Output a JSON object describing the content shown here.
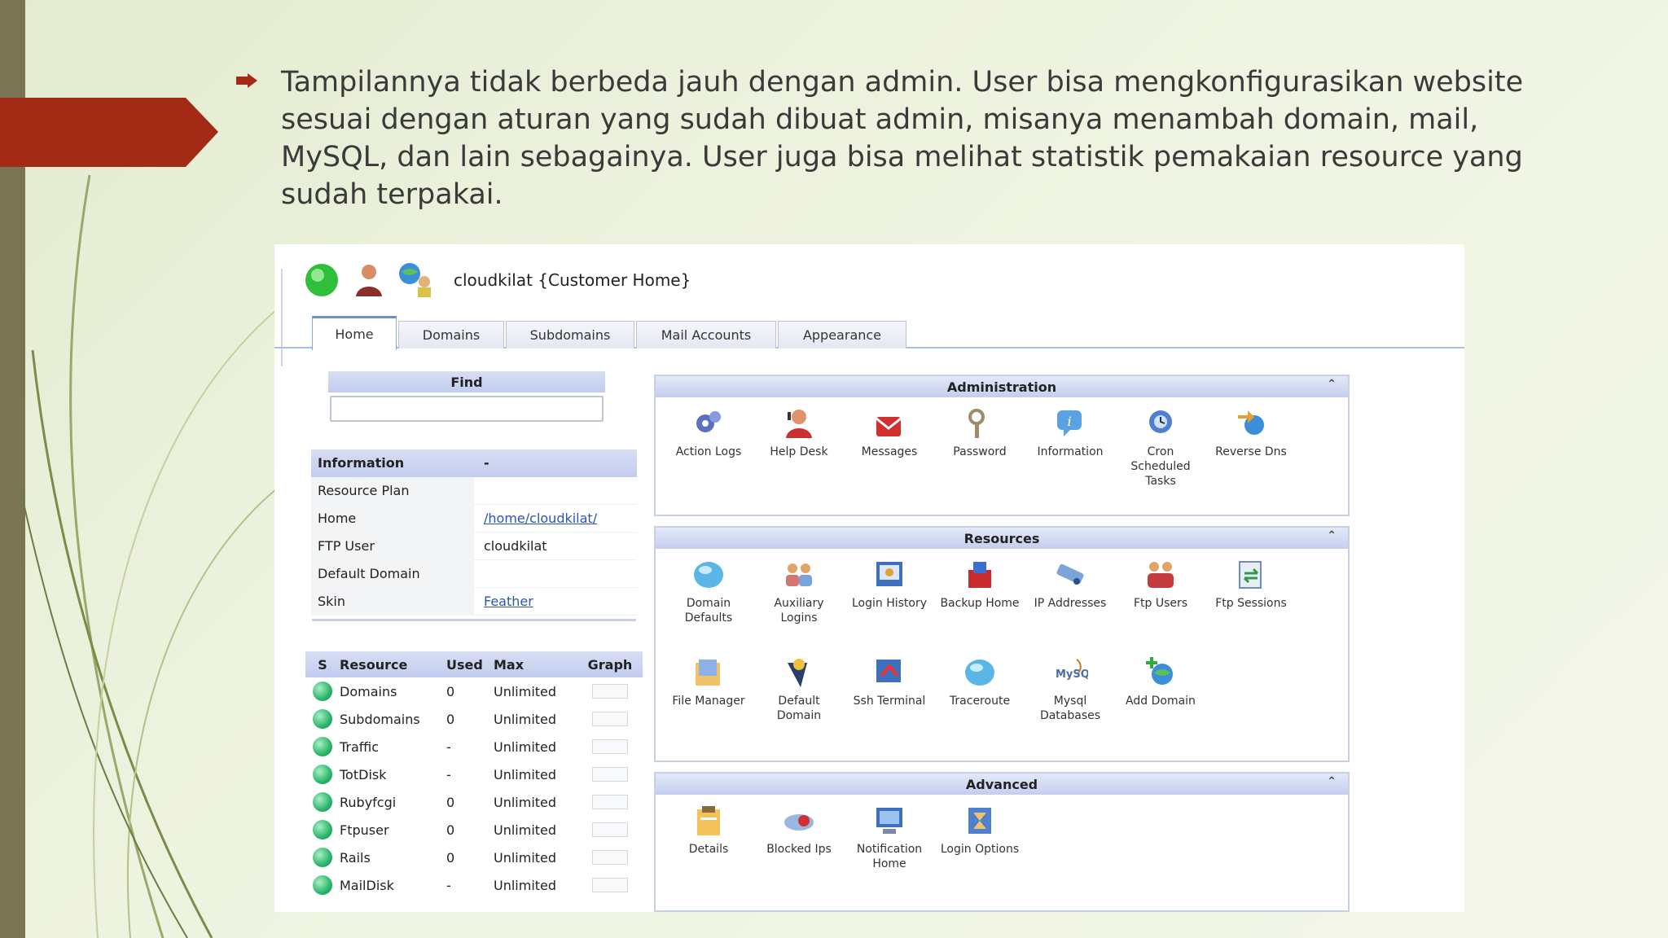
{
  "slide": {
    "bullet_text": "Tampilannya tidak berbeda jauh dengan admin. User bisa mengkonfigurasikan website sesuai dengan aturan yang sudah dibuat admin, misanya menambah domain, mail, MySQL, dan lain sebagainya. User juga bisa melihat statistik pemakaian resource yang sudah terpakai.",
    "colors": {
      "accent_red": "#a32a14",
      "left_bar": "#7a7452",
      "background": "#e8efda"
    }
  },
  "app": {
    "title": "cloudkilat {Customer Home}",
    "tabs": [
      "Home",
      "Domains",
      "Subdomains",
      "Mail Accounts",
      "Appearance"
    ],
    "active_tab": "Home"
  },
  "find": {
    "label": "Find",
    "value": ""
  },
  "info": {
    "header_key": "Information",
    "header_value": "-",
    "rows": [
      {
        "key": "Resource Plan",
        "value": ""
      },
      {
        "key": "Home",
        "value": "/home/cloudkilat/"
      },
      {
        "key": "FTP User",
        "value": "cloudkilat"
      },
      {
        "key": "Default Domain",
        "value": ""
      },
      {
        "key": "Skin",
        "value": "Feather"
      }
    ]
  },
  "resources_table": {
    "headers": [
      "S",
      "Resource",
      "Used",
      "Max",
      "Graph"
    ],
    "rows": [
      {
        "resource": "Domains",
        "used": "0",
        "max": "Unlimited"
      },
      {
        "resource": "Subdomains",
        "used": "0",
        "max": "Unlimited"
      },
      {
        "resource": "Traffic",
        "used": "-",
        "max": "Unlimited"
      },
      {
        "resource": "TotDisk",
        "used": "-",
        "max": "Unlimited"
      },
      {
        "resource": "Rubyfcgi",
        "used": "0",
        "max": "Unlimited"
      },
      {
        "resource": "Ftpuser",
        "used": "0",
        "max": "Unlimited"
      },
      {
        "resource": "Rails",
        "used": "0",
        "max": "Unlimited"
      },
      {
        "resource": "MailDisk",
        "used": "-",
        "max": "Unlimited"
      }
    ]
  },
  "sections": {
    "administration": {
      "title": "Administration",
      "items": [
        {
          "label": "Action Logs",
          "icon": "gears-icon"
        },
        {
          "label": "Help Desk",
          "icon": "help-desk-icon"
        },
        {
          "label": "Messages",
          "icon": "messages-icon"
        },
        {
          "label": "Password",
          "icon": "key-icon"
        },
        {
          "label": "Information",
          "icon": "info-icon"
        },
        {
          "label": "Cron Scheduled Tasks",
          "icon": "cron-icon"
        },
        {
          "label": "Reverse Dns",
          "icon": "reverse-dns-icon"
        }
      ]
    },
    "resources": {
      "title": "Resources",
      "items": [
        {
          "label": "Domain Defaults",
          "icon": "domain-defaults-icon"
        },
        {
          "label": "Auxiliary Logins",
          "icon": "users-icon"
        },
        {
          "label": "Login History",
          "icon": "login-history-icon"
        },
        {
          "label": "Backup Home",
          "icon": "backup-icon"
        },
        {
          "label": "IP Addresses",
          "icon": "ip-icon"
        },
        {
          "label": "Ftp Users",
          "icon": "ftp-users-icon"
        },
        {
          "label": "Ftp Sessions",
          "icon": "ftp-sessions-icon"
        },
        {
          "label": "File Manager",
          "icon": "file-manager-icon"
        },
        {
          "label": "Default Domain",
          "icon": "default-domain-icon"
        },
        {
          "label": "Ssh Terminal",
          "icon": "terminal-icon"
        },
        {
          "label": "Traceroute",
          "icon": "traceroute-icon"
        },
        {
          "label": "Mysql Databases",
          "icon": "mysql-icon"
        },
        {
          "label": "Add Domain",
          "icon": "add-domain-icon"
        }
      ]
    },
    "advanced": {
      "title": "Advanced",
      "items": [
        {
          "label": "Details",
          "icon": "details-icon"
        },
        {
          "label": "Blocked Ips",
          "icon": "blocked-icon"
        },
        {
          "label": "Notification Home",
          "icon": "notification-icon"
        },
        {
          "label": "Login Options",
          "icon": "login-options-icon"
        }
      ]
    }
  }
}
